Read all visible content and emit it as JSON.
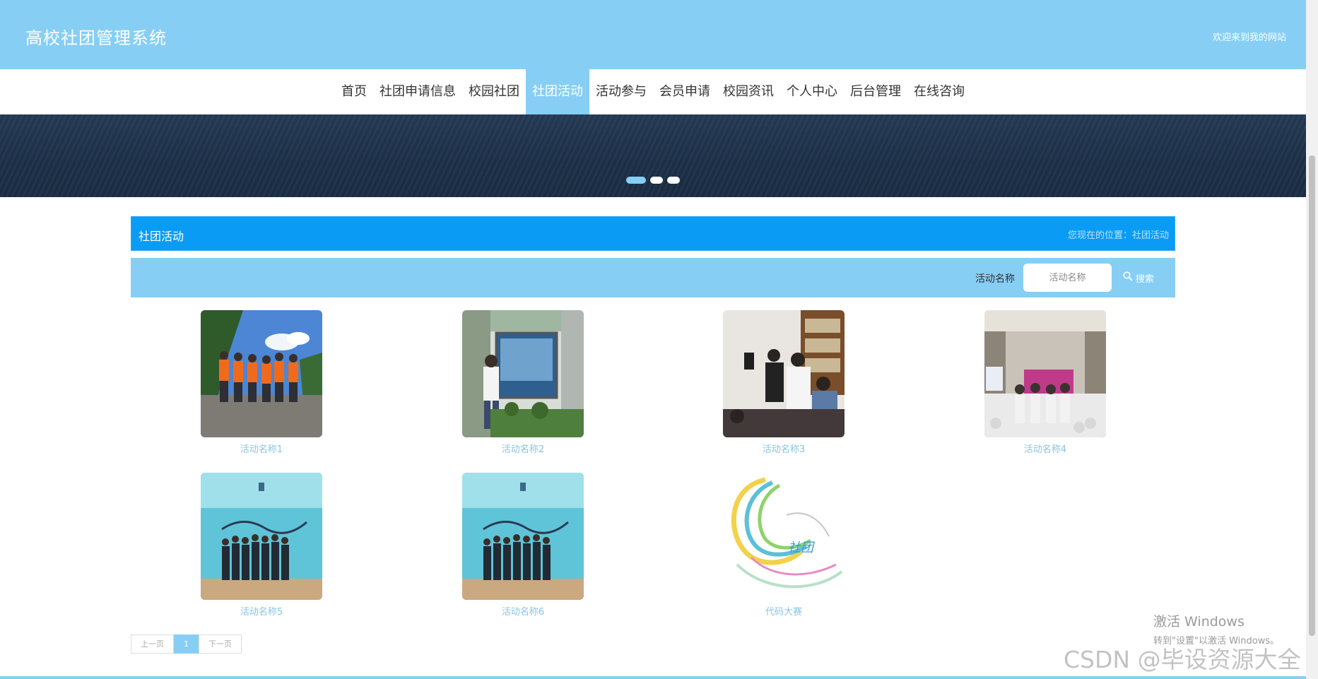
{
  "header": {
    "title": "高校社团管理系统",
    "welcome": "欢迎来到我的网站"
  },
  "nav": {
    "items": [
      {
        "label": "首页"
      },
      {
        "label": "社团申请信息"
      },
      {
        "label": "校园社团"
      },
      {
        "label": "社团活动",
        "active": true
      },
      {
        "label": "活动参与"
      },
      {
        "label": "会员申请"
      },
      {
        "label": "校园资讯"
      },
      {
        "label": "个人中心"
      },
      {
        "label": "后台管理"
      },
      {
        "label": "在线咨询"
      }
    ]
  },
  "banner": {
    "dots": 3,
    "active_dot": 1
  },
  "section": {
    "title": "社团活动",
    "breadcrumb": "您现在的位置：社团活动"
  },
  "search": {
    "label": "活动名称",
    "placeholder": "活动名称",
    "button_label": "搜索",
    "button_icon": "search-icon"
  },
  "activities": [
    {
      "name": "活动名称1",
      "image": "outdoor-group-photo"
    },
    {
      "name": "活动名称2",
      "image": "person-at-display-board"
    },
    {
      "name": "活动名称3",
      "image": "library-gathering"
    },
    {
      "name": "活动名称4",
      "image": "conference-hall"
    },
    {
      "name": "活动名称5",
      "image": "stage-group-photo"
    },
    {
      "name": "活动名称6",
      "image": "stage-group-photo"
    },
    {
      "name": "代码大赛",
      "image": "abstract-logo"
    }
  ],
  "pagination": {
    "prev": "上一页",
    "current": "1",
    "next": "下一页"
  },
  "watermark": {
    "activate_title": "激活 Windows",
    "activate_sub": "转到\"设置\"以激活 Windows。",
    "csdn": "CSDN @毕设资源大全"
  },
  "colors": {
    "header_bg": "#87cef5",
    "title_bar_bg": "#0a9cf5",
    "link_text": "#87c4e6"
  }
}
